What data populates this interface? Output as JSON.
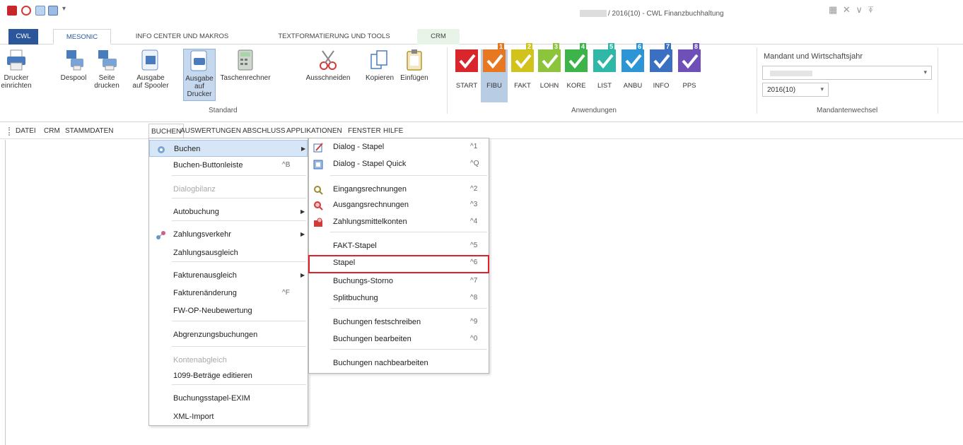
{
  "window": {
    "title": "/ 2016(10) - CWL Finanzbuchhaltung",
    "qa_icons": [
      "app-icon",
      "pdf-icon",
      "window-icon",
      "page-icon"
    ],
    "qa_arrow": "▾",
    "controls": "▦ ✕ ∨ ⍕"
  },
  "tabs": [
    "CWL",
    "MESONIC",
    "INFO CENTER UND MAKROS",
    "TEXTFORMATIERUNG UND TOOLS",
    "CRM"
  ],
  "ribbon": {
    "standard_buttons": [
      {
        "line1": "Drucker",
        "line2": "einrichten",
        "icon": "printer-icon"
      },
      {
        "line1": "Despool",
        "line2": "",
        "icon": "despool-icon"
      },
      {
        "line1": "Seite",
        "line2": "drucken",
        "icon": "print-page-icon"
      },
      {
        "line1": "Ausgabe",
        "line2": "auf Spooler",
        "icon": "spooler-icon"
      },
      {
        "line1": "Ausgabe",
        "line2": "auf Drucker",
        "icon": "output-printer-icon"
      },
      {
        "line1": "Taschenrechner",
        "line2": "",
        "icon": "calculator-icon"
      },
      {
        "line1": "Ausschneiden",
        "line2": "",
        "icon": "scissors-icon"
      },
      {
        "line1": "Kopieren",
        "line2": "",
        "icon": "copy-icon"
      },
      {
        "line1": "Einfügen",
        "line2": "",
        "icon": "paste-icon"
      }
    ],
    "standard_label": "Standard",
    "apps": [
      {
        "label": "START",
        "color": "#d9262c",
        "num": ""
      },
      {
        "label": "FIBU",
        "color": "#e87722",
        "num": "1"
      },
      {
        "label": "FAKT",
        "color": "#d1c21c",
        "num": "2"
      },
      {
        "label": "LOHN",
        "color": "#8cc43c",
        "num": "3"
      },
      {
        "label": "KORE",
        "color": "#3cb44a",
        "num": "4"
      },
      {
        "label": "LIST",
        "color": "#2fb7a7",
        "num": "5"
      },
      {
        "label": "ANBU",
        "color": "#2c95d6",
        "num": "6"
      },
      {
        "label": "INFO",
        "color": "#3a6fc2",
        "num": "7"
      },
      {
        "label": "PPS",
        "color": "#6f4fb8",
        "num": "8"
      }
    ],
    "apps_label": "Anwendungen",
    "mandant_title": "Mandant und Wirtschaftsjahr",
    "year_value": "2016(10)",
    "mandant_label": "Mandantenwechsel",
    "combo_arrow": "▾"
  },
  "menubar": [
    "DATEI",
    "CRM",
    "STAMMDATEN",
    "BUCHEN",
    "AUSWERTUNGEN",
    "ABSCHLUSS",
    "APPLIKATIONEN",
    "FENSTER",
    "HILFE"
  ],
  "buchen_menu": [
    {
      "label": "Buchen",
      "shortcut": "",
      "arrow": "▶",
      "disabled": false,
      "icon": "buchen-icon"
    },
    {
      "label": "Buchen-Buttonleiste",
      "shortcut": "^B",
      "arrow": "",
      "disabled": false,
      "icon": ""
    },
    {
      "label": "Dialogbilanz",
      "shortcut": "",
      "arrow": "",
      "disabled": true,
      "icon": ""
    },
    {
      "label": "Autobuchung",
      "shortcut": "",
      "arrow": "▶",
      "disabled": false,
      "icon": ""
    },
    {
      "label": "Zahlungsverkehr",
      "shortcut": "",
      "arrow": "▶",
      "disabled": false,
      "icon": "zahlungsverkehr-icon"
    },
    {
      "label": "Zahlungsausgleich",
      "shortcut": "",
      "arrow": "",
      "disabled": false,
      "icon": ""
    },
    {
      "label": "Fakturenausgleich",
      "shortcut": "",
      "arrow": "▶",
      "disabled": false,
      "icon": ""
    },
    {
      "label": "Fakturenänderung",
      "shortcut": "^F",
      "arrow": "",
      "disabled": false,
      "icon": ""
    },
    {
      "label": "FW-OP-Neubewertung",
      "shortcut": "",
      "arrow": "",
      "disabled": false,
      "icon": ""
    },
    {
      "label": "Abgrenzungsbuchungen",
      "shortcut": "",
      "arrow": "",
      "disabled": false,
      "icon": ""
    },
    {
      "label": "Kontenabgleich",
      "shortcut": "",
      "arrow": "",
      "disabled": true,
      "icon": ""
    },
    {
      "label": "1099-Beträge editieren",
      "shortcut": "",
      "arrow": "",
      "disabled": false,
      "icon": ""
    },
    {
      "label": "Buchungsstapel-EXIM",
      "shortcut": "",
      "arrow": "",
      "disabled": false,
      "icon": ""
    },
    {
      "label": "XML-Import",
      "shortcut": "",
      "arrow": "",
      "disabled": false,
      "icon": ""
    }
  ],
  "sub_menu": [
    {
      "label": "Dialog - Stapel",
      "shortcut": "^1",
      "icon": "dialog-stapel-icon"
    },
    {
      "label": "Dialog - Stapel Quick",
      "shortcut": "^Q",
      "icon": "stapel-quick-icon"
    },
    {
      "label": "Eingangsrechnungen",
      "shortcut": "^2",
      "icon": "eingang-icon"
    },
    {
      "label": "Ausgangsrechnungen",
      "shortcut": "^3",
      "icon": "ausgang-icon"
    },
    {
      "label": "Zahlungsmittelkonten",
      "shortcut": "^4",
      "icon": "zahlungsmittel-icon"
    },
    {
      "label": "FAKT-Stapel",
      "shortcut": "^5",
      "icon": ""
    },
    {
      "label": "Stapel",
      "shortcut": "^6",
      "icon": ""
    },
    {
      "label": "Buchungs-Storno",
      "shortcut": "^7",
      "icon": ""
    },
    {
      "label": "Splitbuchung",
      "shortcut": "^8",
      "icon": ""
    },
    {
      "label": "Buchungen festschreiben",
      "shortcut": "^9",
      "icon": ""
    },
    {
      "label": "Buchungen bearbeiten",
      "shortcut": "^0",
      "icon": ""
    },
    {
      "label": "Buchungen nachbearbeiten",
      "shortcut": "",
      "icon": ""
    }
  ]
}
